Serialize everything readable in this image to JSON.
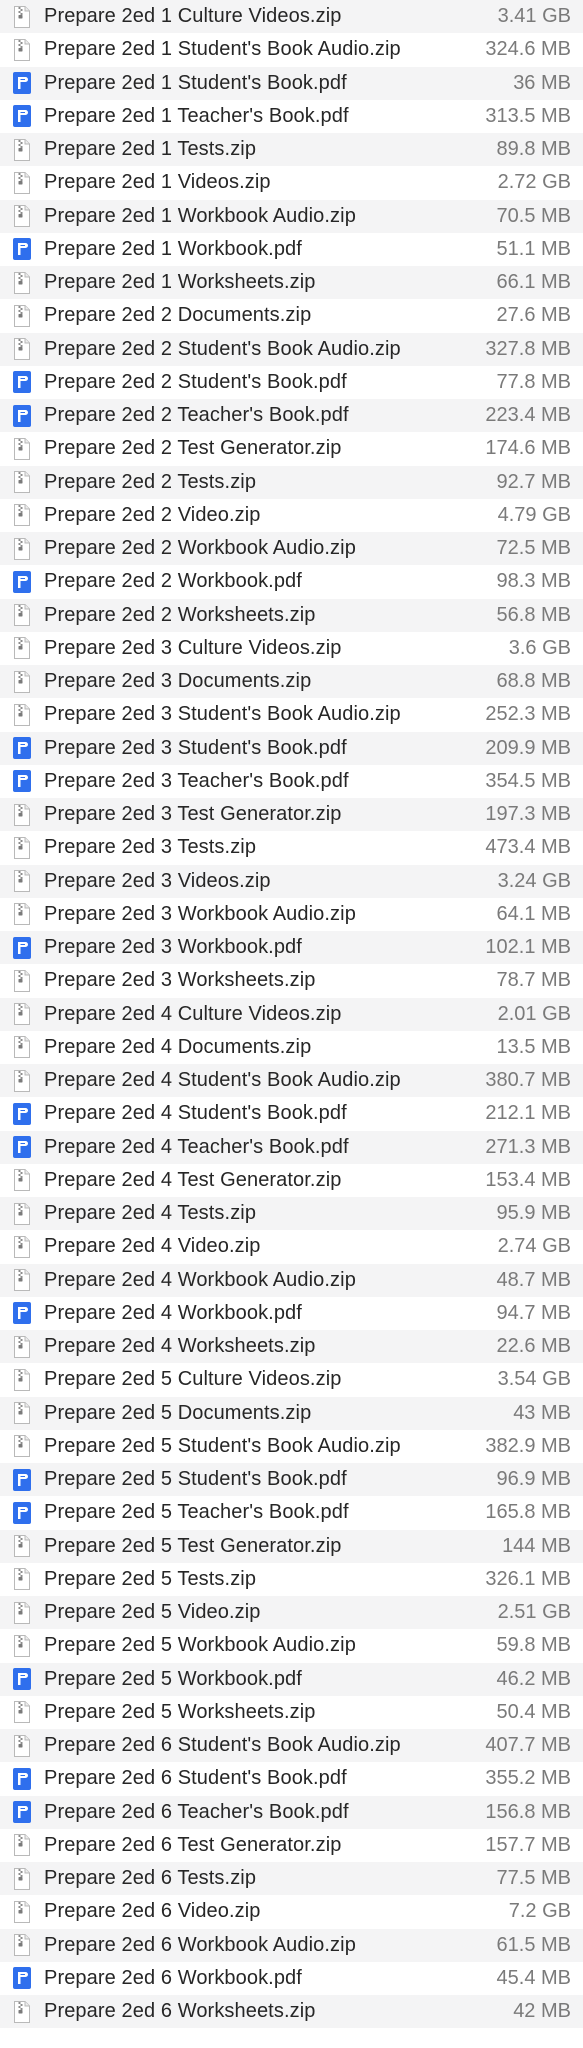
{
  "files": [
    {
      "name": "Prepare 2ed 1 Culture Videos.zip",
      "size": "3.41 GB",
      "icon": "zip-archive-icon"
    },
    {
      "name": "Prepare 2ed 1 Student's Book Audio.zip",
      "size": "324.6 MB",
      "icon": "zip-archive-icon"
    },
    {
      "name": "Prepare 2ed 1 Student's Book.pdf",
      "size": "36 MB",
      "icon": "pdf-document-icon"
    },
    {
      "name": "Prepare 2ed 1 Teacher's Book.pdf",
      "size": "313.5 MB",
      "icon": "pdf-document-icon"
    },
    {
      "name": "Prepare 2ed 1 Tests.zip",
      "size": "89.8 MB",
      "icon": "zip-archive-icon"
    },
    {
      "name": "Prepare 2ed 1 Videos.zip",
      "size": "2.72 GB",
      "icon": "zip-archive-icon"
    },
    {
      "name": "Prepare 2ed 1 Workbook Audio.zip",
      "size": "70.5 MB",
      "icon": "zip-archive-icon"
    },
    {
      "name": "Prepare 2ed 1 Workbook.pdf",
      "size": "51.1 MB",
      "icon": "pdf-document-icon"
    },
    {
      "name": "Prepare 2ed 1 Worksheets.zip",
      "size": "66.1 MB",
      "icon": "zip-archive-icon"
    },
    {
      "name": "Prepare 2ed 2 Documents.zip",
      "size": "27.6 MB",
      "icon": "zip-archive-icon"
    },
    {
      "name": "Prepare 2ed 2 Student's Book Audio.zip",
      "size": "327.8 MB",
      "icon": "zip-archive-icon"
    },
    {
      "name": "Prepare 2ed 2 Student's Book.pdf",
      "size": "77.8 MB",
      "icon": "pdf-document-icon"
    },
    {
      "name": "Prepare 2ed 2 Teacher's Book.pdf",
      "size": "223.4 MB",
      "icon": "pdf-document-icon"
    },
    {
      "name": "Prepare 2ed 2 Test Generator.zip",
      "size": "174.6 MB",
      "icon": "zip-archive-icon"
    },
    {
      "name": "Prepare 2ed 2 Tests.zip",
      "size": "92.7 MB",
      "icon": "zip-archive-icon"
    },
    {
      "name": "Prepare 2ed 2 Video.zip",
      "size": "4.79 GB",
      "icon": "zip-archive-icon"
    },
    {
      "name": "Prepare 2ed 2 Workbook Audio.zip",
      "size": "72.5 MB",
      "icon": "zip-archive-icon"
    },
    {
      "name": "Prepare 2ed 2 Workbook.pdf",
      "size": "98.3 MB",
      "icon": "pdf-document-icon"
    },
    {
      "name": "Prepare 2ed 2 Worksheets.zip",
      "size": "56.8 MB",
      "icon": "zip-archive-icon"
    },
    {
      "name": "Prepare 2ed 3 Culture Videos.zip",
      "size": "3.6 GB",
      "icon": "zip-archive-icon"
    },
    {
      "name": "Prepare 2ed 3 Documents.zip",
      "size": "68.8 MB",
      "icon": "zip-archive-icon"
    },
    {
      "name": "Prepare 2ed 3 Student's Book Audio.zip",
      "size": "252.3 MB",
      "icon": "zip-archive-icon"
    },
    {
      "name": "Prepare 2ed 3 Student's Book.pdf",
      "size": "209.9 MB",
      "icon": "pdf-document-icon"
    },
    {
      "name": "Prepare 2ed 3 Teacher's Book.pdf",
      "size": "354.5 MB",
      "icon": "pdf-document-icon"
    },
    {
      "name": "Prepare 2ed 3 Test Generator.zip",
      "size": "197.3 MB",
      "icon": "zip-archive-icon"
    },
    {
      "name": "Prepare 2ed 3 Tests.zip",
      "size": "473.4 MB",
      "icon": "zip-archive-icon"
    },
    {
      "name": "Prepare 2ed 3 Videos.zip",
      "size": "3.24 GB",
      "icon": "zip-archive-icon"
    },
    {
      "name": "Prepare 2ed 3 Workbook Audio.zip",
      "size": "64.1 MB",
      "icon": "zip-archive-icon"
    },
    {
      "name": "Prepare 2ed 3 Workbook.pdf",
      "size": "102.1 MB",
      "icon": "pdf-document-icon"
    },
    {
      "name": "Prepare 2ed 3 Worksheets.zip",
      "size": "78.7 MB",
      "icon": "zip-archive-icon"
    },
    {
      "name": "Prepare 2ed 4 Culture Videos.zip",
      "size": "2.01 GB",
      "icon": "zip-archive-icon"
    },
    {
      "name": "Prepare 2ed 4 Documents.zip",
      "size": "13.5 MB",
      "icon": "zip-archive-icon"
    },
    {
      "name": "Prepare 2ed 4 Student's Book Audio.zip",
      "size": "380.7 MB",
      "icon": "zip-archive-icon"
    },
    {
      "name": "Prepare 2ed 4 Student's Book.pdf",
      "size": "212.1 MB",
      "icon": "pdf-document-icon"
    },
    {
      "name": "Prepare 2ed 4 Teacher's Book.pdf",
      "size": "271.3 MB",
      "icon": "pdf-document-icon"
    },
    {
      "name": "Prepare 2ed 4 Test Generator.zip",
      "size": "153.4 MB",
      "icon": "zip-archive-icon"
    },
    {
      "name": "Prepare 2ed 4 Tests.zip",
      "size": "95.9 MB",
      "icon": "zip-archive-icon"
    },
    {
      "name": "Prepare 2ed 4 Video.zip",
      "size": "2.74 GB",
      "icon": "zip-archive-icon"
    },
    {
      "name": "Prepare 2ed 4 Workbook Audio.zip",
      "size": "48.7 MB",
      "icon": "zip-archive-icon"
    },
    {
      "name": "Prepare 2ed 4 Workbook.pdf",
      "size": "94.7 MB",
      "icon": "pdf-document-icon"
    },
    {
      "name": "Prepare 2ed 4 Worksheets.zip",
      "size": "22.6 MB",
      "icon": "zip-archive-icon"
    },
    {
      "name": "Prepare 2ed 5 Culture Videos.zip",
      "size": "3.54 GB",
      "icon": "zip-archive-icon"
    },
    {
      "name": "Prepare 2ed 5 Documents.zip",
      "size": "43 MB",
      "icon": "zip-archive-icon"
    },
    {
      "name": "Prepare 2ed 5 Student's Book Audio.zip",
      "size": "382.9 MB",
      "icon": "zip-archive-icon"
    },
    {
      "name": "Prepare 2ed 5 Student's Book.pdf",
      "size": "96.9 MB",
      "icon": "pdf-document-icon"
    },
    {
      "name": "Prepare 2ed 5 Teacher's Book.pdf",
      "size": "165.8 MB",
      "icon": "pdf-document-icon"
    },
    {
      "name": "Prepare 2ed 5 Test Generator.zip",
      "size": "144 MB",
      "icon": "zip-archive-icon"
    },
    {
      "name": "Prepare 2ed 5 Tests.zip",
      "size": "326.1 MB",
      "icon": "zip-archive-icon"
    },
    {
      "name": "Prepare 2ed 5 Video.zip",
      "size": "2.51 GB",
      "icon": "zip-archive-icon"
    },
    {
      "name": "Prepare 2ed 5 Workbook Audio.zip",
      "size": "59.8 MB",
      "icon": "zip-archive-icon"
    },
    {
      "name": "Prepare 2ed 5 Workbook.pdf",
      "size": "46.2 MB",
      "icon": "pdf-document-icon"
    },
    {
      "name": "Prepare 2ed 5 Worksheets.zip",
      "size": "50.4 MB",
      "icon": "zip-archive-icon"
    },
    {
      "name": "Prepare 2ed 6 Student's Book Audio.zip",
      "size": "407.7 MB",
      "icon": "zip-archive-icon"
    },
    {
      "name": "Prepare 2ed 6 Student's Book.pdf",
      "size": "355.2 MB",
      "icon": "pdf-document-icon"
    },
    {
      "name": "Prepare 2ed 6 Teacher's Book.pdf",
      "size": "156.8 MB",
      "icon": "pdf-document-icon"
    },
    {
      "name": "Prepare 2ed 6 Test Generator.zip",
      "size": "157.7 MB",
      "icon": "zip-archive-icon"
    },
    {
      "name": "Prepare 2ed 6 Tests.zip",
      "size": "77.5 MB",
      "icon": "zip-archive-icon"
    },
    {
      "name": "Prepare 2ed 6 Video.zip",
      "size": "7.2 GB",
      "icon": "zip-archive-icon"
    },
    {
      "name": "Prepare 2ed 6 Workbook Audio.zip",
      "size": "61.5 MB",
      "icon": "zip-archive-icon"
    },
    {
      "name": "Prepare 2ed 6 Workbook.pdf",
      "size": "45.4 MB",
      "icon": "pdf-document-icon"
    },
    {
      "name": "Prepare 2ed 6 Worksheets.zip",
      "size": "42 MB",
      "icon": "zip-archive-icon"
    }
  ],
  "colors": {
    "row_alt": "#f4f4f5",
    "pdf_icon": "#2f6fed",
    "size_text": "#7a7a7a",
    "name_text": "#262626"
  }
}
